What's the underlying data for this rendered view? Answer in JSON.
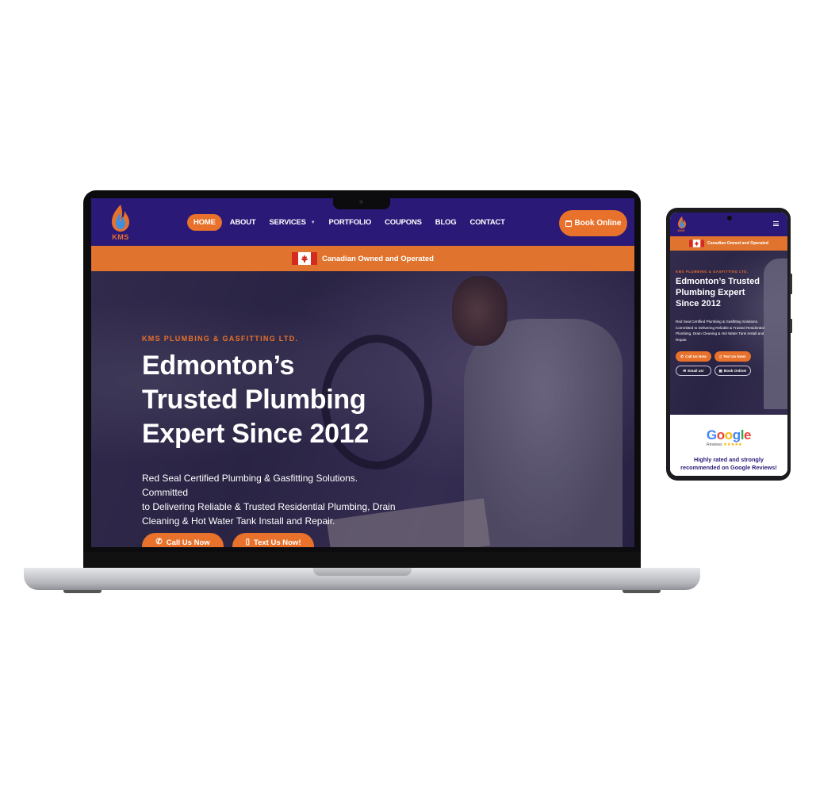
{
  "brand": {
    "logo_text": "KMS",
    "primary_color": "#2b1978",
    "accent_color": "#e8712b"
  },
  "desktop": {
    "nav": {
      "items": [
        {
          "label": "HOME",
          "active": true
        },
        {
          "label": "ABOUT",
          "active": false
        },
        {
          "label": "SERVICES",
          "active": false,
          "has_dropdown": true
        },
        {
          "label": "PORTFOLIO",
          "active": false
        },
        {
          "label": "COUPONS",
          "active": false
        },
        {
          "label": "BLOG",
          "active": false
        },
        {
          "label": "CONTACT",
          "active": false
        }
      ],
      "book_button": "Book Online",
      "book_icon": "calendar-icon"
    },
    "banner": {
      "text": "Canadian Owned and Operated",
      "flag": "canada-flag-icon"
    },
    "hero": {
      "eyebrow": "KMS PLUMBING & GASFITTING LTD.",
      "title_lines": [
        "Edmonton’s",
        "Trusted Plumbing",
        "Expert Since 2012"
      ],
      "description_lines": [
        "Red Seal Certified Plumbing & Gasfitting Solutions. Committed",
        "to Delivering Reliable & Trusted Residential Plumbing, Drain",
        "Cleaning & Hot Water Tank Install and Repair."
      ],
      "buttons": [
        {
          "label": "Call Us Now",
          "icon": "phone-icon"
        },
        {
          "label": "Text Us Now!",
          "icon": "mobile-icon"
        }
      ]
    }
  },
  "mobile": {
    "banner": {
      "text": "Canadian Owned and Operated"
    },
    "hero": {
      "eyebrow": "KMS PLUMBING & GASFITTING LTD.",
      "title_lines": [
        "Edmonton’s Trusted",
        "Plumbing Expert",
        "Since 2012"
      ],
      "description_lines": [
        "Red Seal Certified Plumbing & Gasfitting Solutions.",
        "Committed to Delivering Reliable & Trusted Residential",
        "Plumbing, Drain Cleaning & Hot Water Tank Install and",
        "Repair."
      ],
      "buttons": [
        {
          "label": "Call Us Now",
          "icon": "phone-icon"
        },
        {
          "label": "Text Us Now!",
          "icon": "mobile-icon"
        },
        {
          "label": "Email us!",
          "icon": "mail-icon"
        },
        {
          "label": "Book Online!",
          "icon": "calendar-icon"
        }
      ]
    },
    "reviews": {
      "logo": "Google",
      "sub": "Reviews",
      "stars": "★★★★★",
      "lines": [
        "Highly rated and strongly",
        "recommended on Google Reviews!"
      ]
    }
  }
}
